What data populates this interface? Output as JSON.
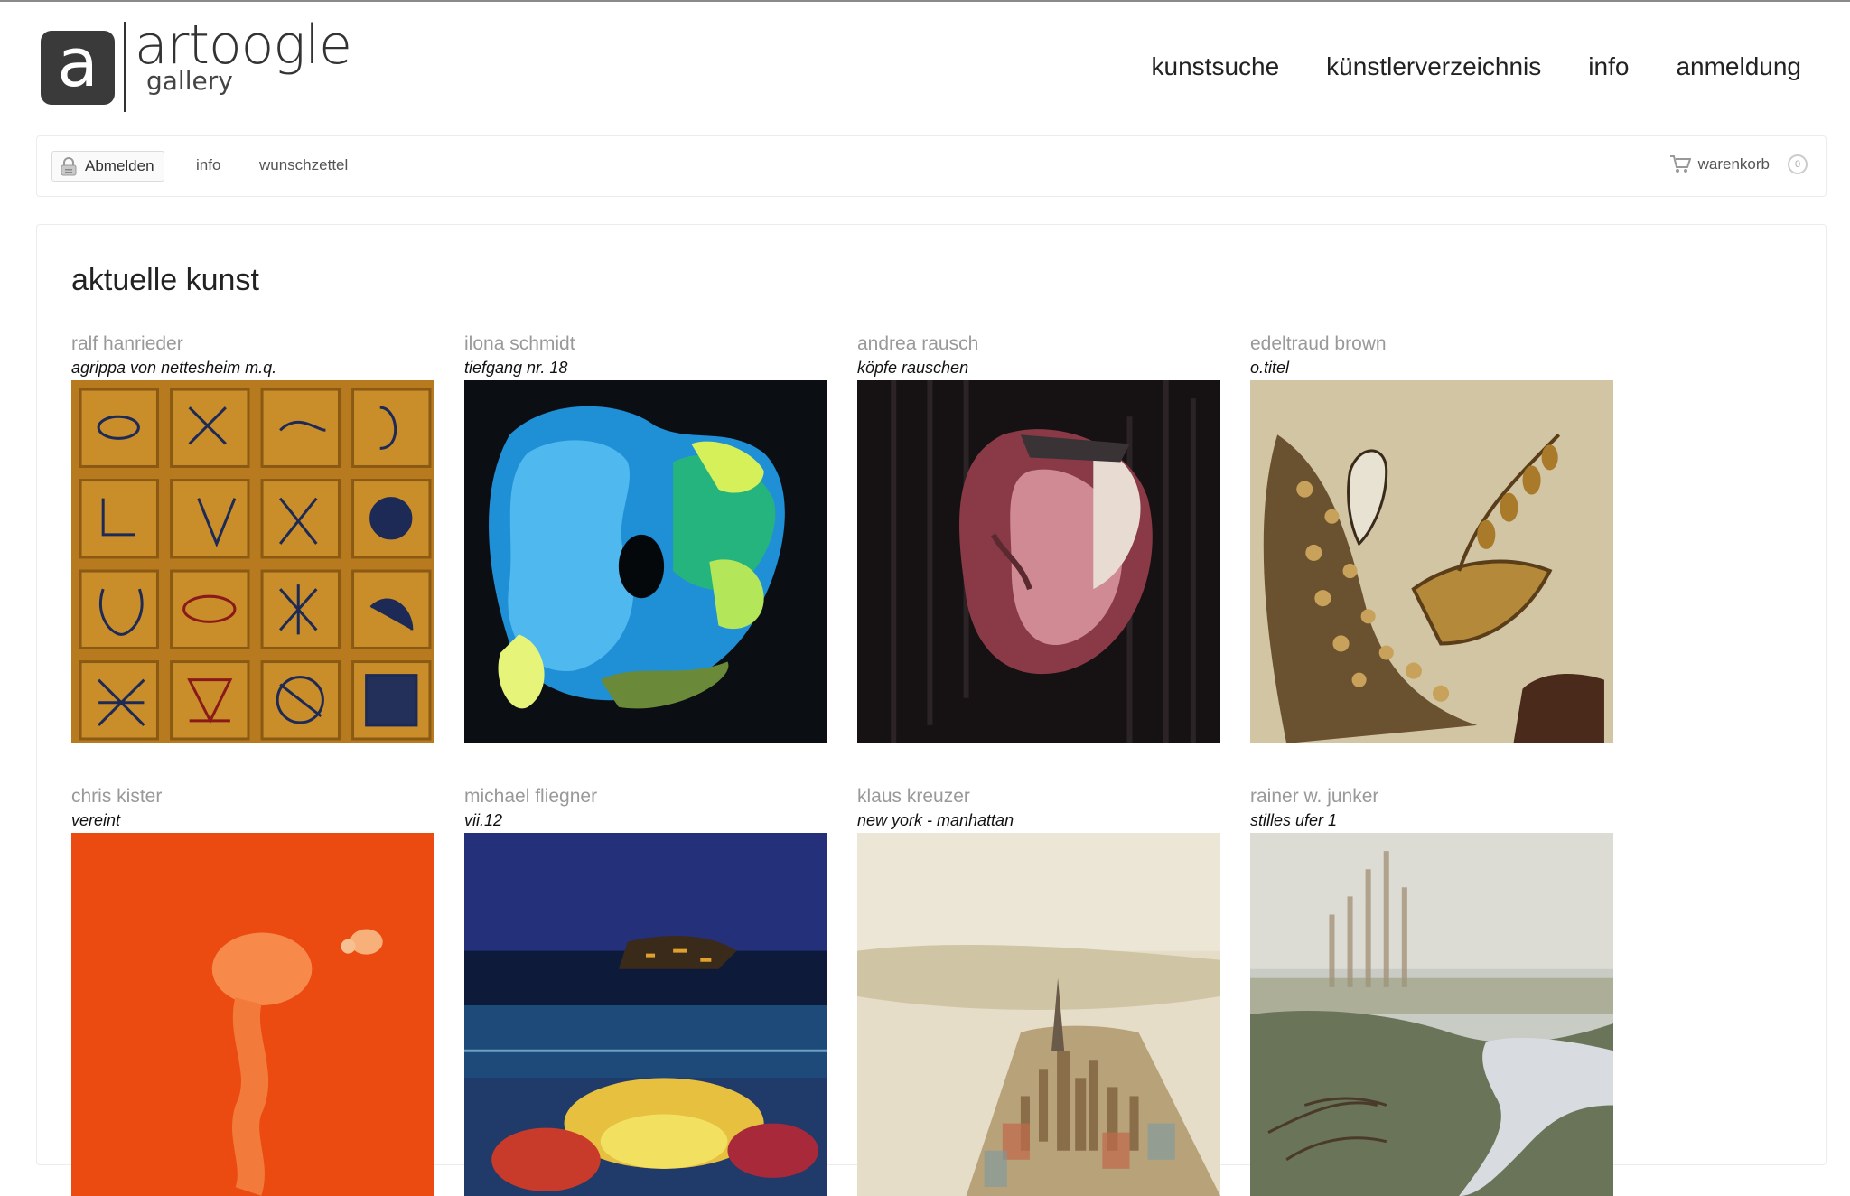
{
  "logo": {
    "mark": "a",
    "name": "artoogle",
    "sub": "gallery"
  },
  "nav": [
    "kunstsuche",
    "künstlerverzeichnis",
    "info",
    "anmeldung"
  ],
  "toolbar": {
    "logout_label": "Abmelden",
    "info_label": "info",
    "wishlist_label": "wunschzettel",
    "cart_label": "warenkorb",
    "cart_count": "0"
  },
  "section_title": "aktuelle kunst",
  "artworks": [
    {
      "artist": "ralf hanrieder",
      "title": "agrippa von nettesheim m.q.",
      "theme": "grid-gold"
    },
    {
      "artist": "ilona schmidt",
      "title": "tiefgang nr. 18",
      "theme": "blue-abstract"
    },
    {
      "artist": "andrea rausch",
      "title": "köpfe rauschen",
      "theme": "dark-portrait"
    },
    {
      "artist": "edeltraud brown",
      "title": "o.titel",
      "theme": "beige-feather"
    },
    {
      "artist": "chris kister",
      "title": "vereint",
      "theme": "red-orange"
    },
    {
      "artist": "michael fliegner",
      "title": "vii.12",
      "theme": "dark-blue-sea"
    },
    {
      "artist": "klaus kreuzer",
      "title": "new york - manhattan",
      "theme": "city"
    },
    {
      "artist": "rainer w. junker",
      "title": "stilles ufer 1",
      "theme": "misty-river"
    }
  ]
}
